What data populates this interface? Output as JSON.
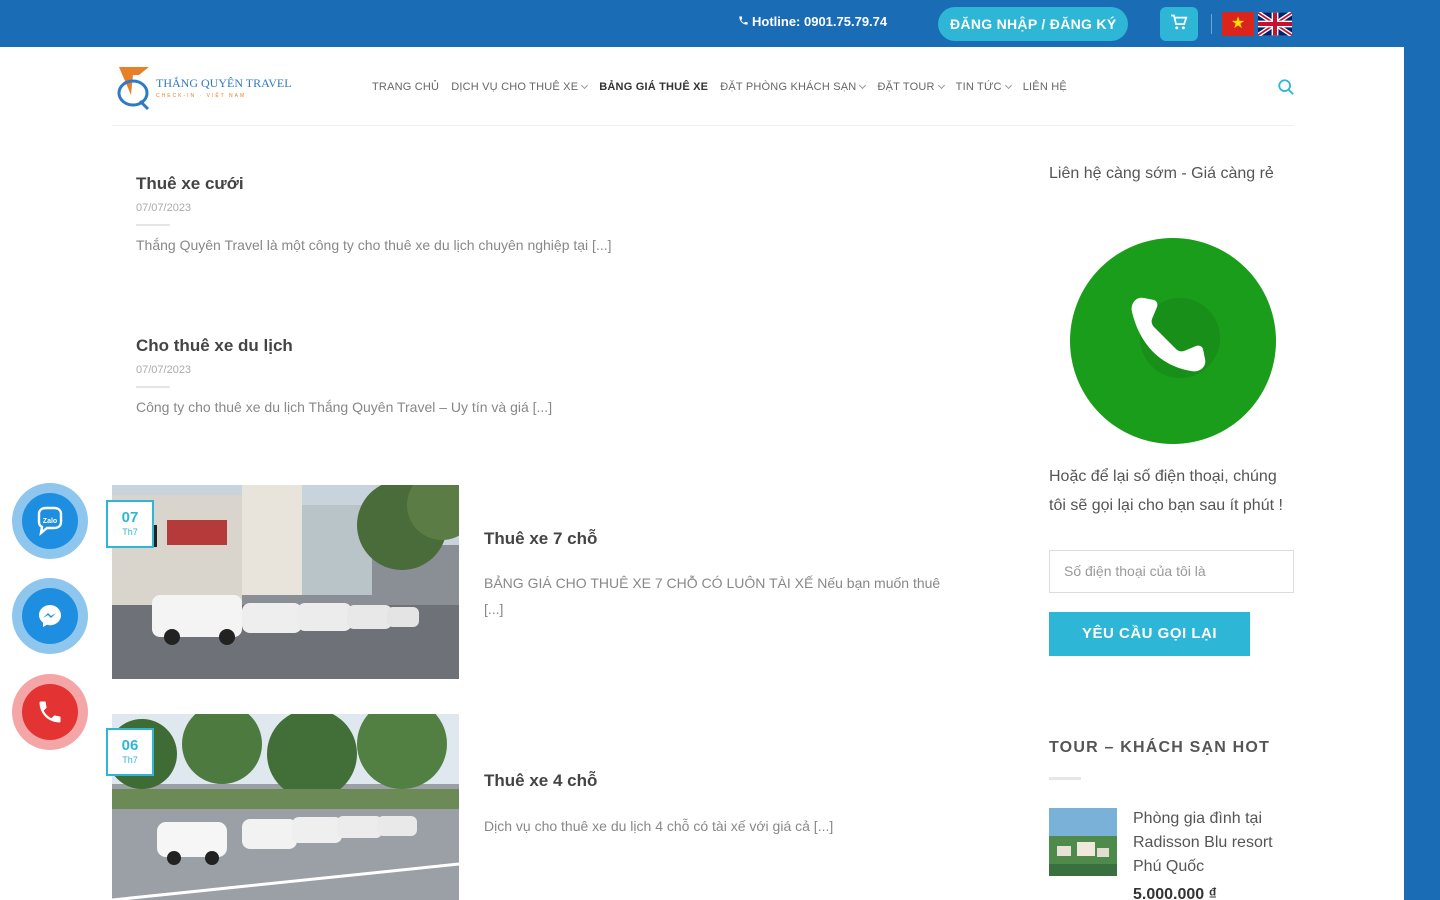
{
  "topbar": {
    "hotline_label": "Hotline: 0901.75.79.74",
    "login_label": "ĐĂNG NHẬP / ĐĂNG KÝ"
  },
  "logo": {
    "title": "THẮNG QUYÊN TRAVEL",
    "tagline": "CHECK-IN · VIỆT NAM"
  },
  "nav": {
    "items": [
      {
        "label": "TRANG CHỦ"
      },
      {
        "label": "DỊCH VỤ CHO THUÊ XE"
      },
      {
        "label": "BẢNG GIÁ THUÊ XE"
      },
      {
        "label": "ĐẶT PHÒNG KHÁCH SẠN"
      },
      {
        "label": "ĐẶT TOUR"
      },
      {
        "label": "TIN TỨC"
      },
      {
        "label": "LIÊN HỆ"
      }
    ]
  },
  "posts": [
    {
      "title": "Thuê xe cưới",
      "date": "07/07/2023",
      "excerpt": "Thắng Quyên Travel là một công ty cho thuê xe du lịch chuyên nghiệp tại [...]"
    },
    {
      "title": "Cho thuê xe du lịch",
      "date": "07/07/2023",
      "excerpt": "Công ty cho thuê xe du lịch Thắng Quyên Travel – Uy tín và giá [...]"
    }
  ],
  "cards": [
    {
      "day": "07",
      "month": "Th7",
      "title": "Thuê xe 7 chỗ",
      "excerpt": "BẢNG GIÁ CHO THUÊ XE 7 CHỖ CÓ LUÔN TÀI XẾ Nếu bạn muốn thuê [...]"
    },
    {
      "day": "06",
      "month": "Th7",
      "title": "Thuê xe 4 chỗ",
      "excerpt": "Dịch vụ cho thuê xe du lịch 4 chỗ có tài xế với giá cả [...]"
    }
  ],
  "sidebar": {
    "contact_text": "Liên hệ càng sớm - Giá càng rẻ",
    "leave_phone_text": "Hoặc để lại số điện thoại, chúng tôi sẽ gọi lại cho bạn sau ít phút !",
    "phone_placeholder": "Số điện thoại của tôi là",
    "callback_label": "YÊU CẦU GỌI LẠI",
    "hot_heading": "TOUR – KHÁCH SẠN HOT",
    "hot_item_title": "Phòng gia đình tại Radisson Blu resort Phú Quốc",
    "hot_item_price": "5.000.000 ₫"
  },
  "floating": {
    "zalo_label": "Zalo"
  },
  "colors": {
    "brand_blue": "#1a6db5",
    "accent_cyan": "#2eb6d6",
    "call_green": "#1a9d1a",
    "call_red": "#e43333"
  }
}
